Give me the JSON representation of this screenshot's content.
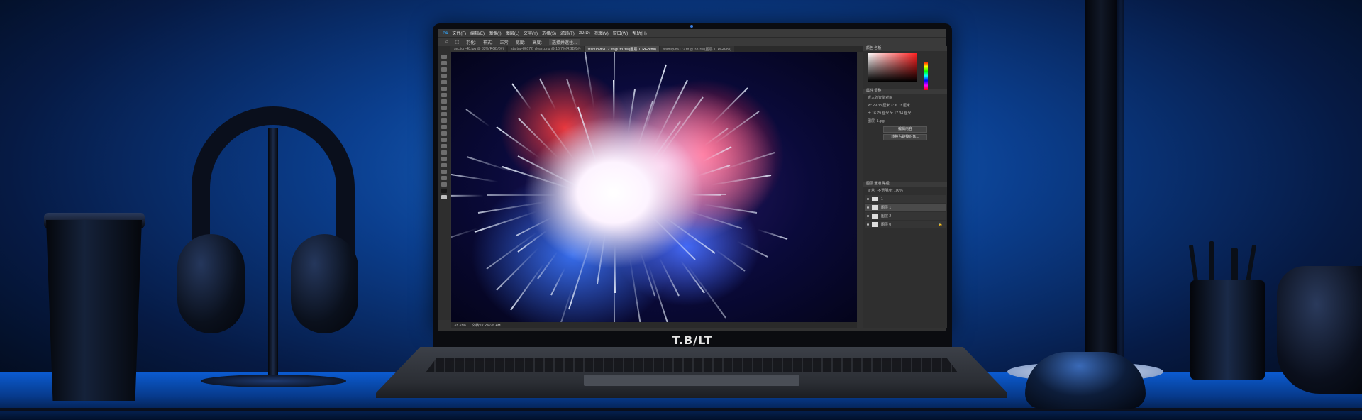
{
  "brand": {
    "name": "T.B∕LT"
  },
  "photoshop": {
    "menu": [
      "文件(F)",
      "编辑(E)",
      "图像(I)",
      "图层(L)",
      "文字(Y)",
      "选择(S)",
      "滤镜(T)",
      "3D(D)",
      "视图(V)",
      "窗口(W)",
      "帮助(H)"
    ],
    "options": [
      "羽化:",
      "样式:",
      "正常",
      "宽度:",
      "高度:",
      "选择并遮住..."
    ],
    "tabs": [
      {
        "label": "section-48.jpg @ 33%(RGB/8#)",
        "active": false
      },
      {
        "label": "startup-86172_clean.png @ 16.7%(RGB/8#)",
        "active": false
      },
      {
        "label": "startup-86172.tif @ 33.3%(图层 1, RGB/8#)",
        "active": true
      },
      {
        "label": "startup-86172.tif @ 33.3%(图层 1, RGB/8#)",
        "active": false
      }
    ],
    "status": {
      "zoom": "33.33%",
      "doc": "文档:17.2M/26.4M"
    },
    "panels": {
      "color_head": "颜色  色板",
      "props_head": "属性  调整",
      "props_lines": [
        "嵌入的智能对象",
        "W: 29.33 厘米   X: 6.73 厘米",
        "H: 16.79 厘米   Y: 17.34 厘米",
        "图层: 1.jpg"
      ],
      "props_buttons": [
        "编辑内容",
        "转换为链接对象..."
      ],
      "layers_head": "图层  通道  路径",
      "layers_mode": "正常",
      "layers_opacity": "不透明度: 100%",
      "layers": [
        {
          "name": "1",
          "selected": false
        },
        {
          "name": "图层 1",
          "selected": true
        },
        {
          "name": "图层 2",
          "selected": false
        },
        {
          "name": "图层 0",
          "selected": false
        }
      ]
    }
  }
}
